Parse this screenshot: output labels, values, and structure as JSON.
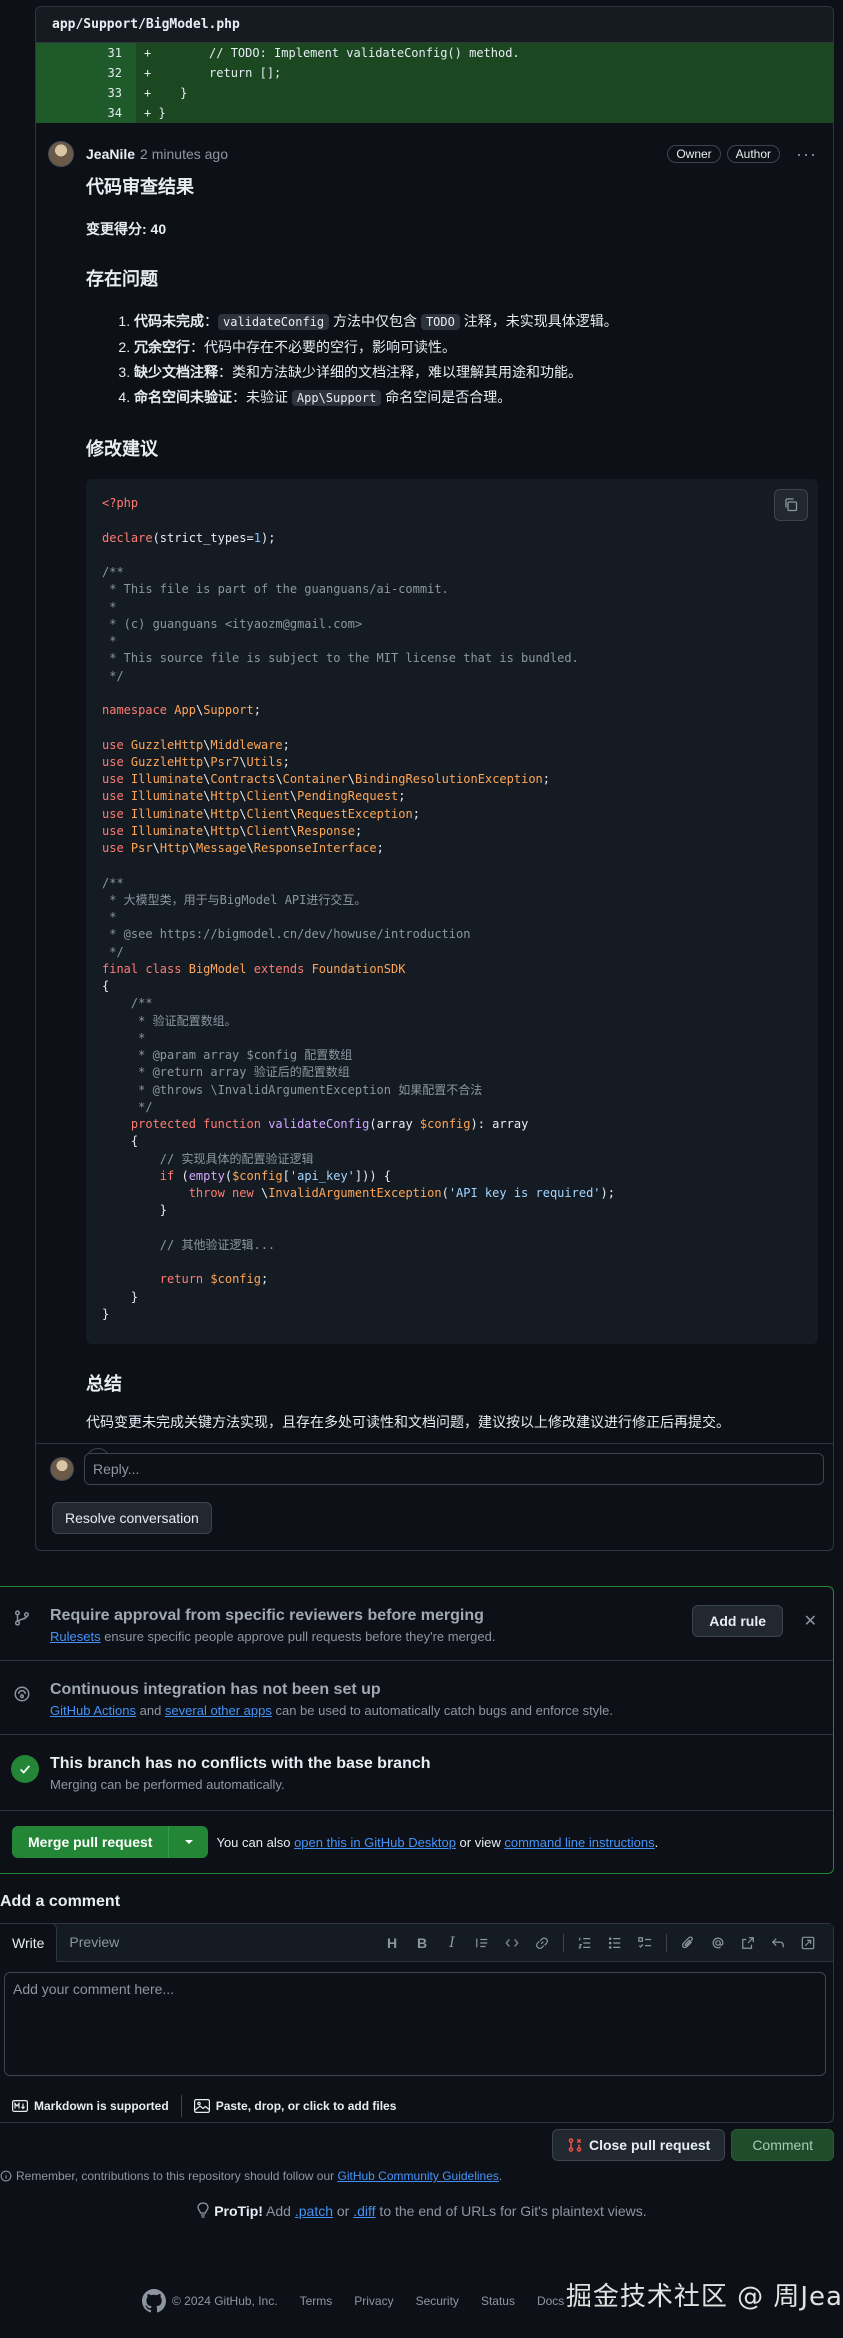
{
  "file": {
    "path": "app/Support/BigModel.php",
    "diff_lines": [
      {
        "num": "31",
        "code": "+        // TODO: Implement validateConfig() method."
      },
      {
        "num": "32",
        "code": "+        return [];"
      },
      {
        "num": "33",
        "code": "+    }"
      },
      {
        "num": "34",
        "code": "+ }"
      }
    ]
  },
  "comment": {
    "author": "JeaNile",
    "time": "2 minutes ago",
    "badges": [
      "Owner",
      "Author"
    ],
    "more": "···",
    "heading": "代码审查结果",
    "score_label": "变更得分: 40",
    "issues_heading": "存在问题",
    "issues": [
      {
        "title": "代码未完成",
        "pre": "：",
        "code1": "validateConfig",
        "mid": " 方法中仅包含 ",
        "code2": "TODO",
        "post": " 注释，未实现具体逻辑。"
      },
      {
        "title": "冗余空行",
        "pre": "：代码中存在不必要的空行，影响可读性。",
        "code1": "",
        "mid": "",
        "code2": "",
        "post": ""
      },
      {
        "title": "缺少文档注释",
        "pre": "：类和方法缺少详细的文档注释，难以理解其用途和功能。",
        "code1": "",
        "mid": "",
        "code2": "",
        "post": ""
      },
      {
        "title": "命名空间未验证",
        "pre": "：未验证 ",
        "code1": "App\\Support",
        "mid": " 命名空间是否合理。",
        "code2": "",
        "post": ""
      }
    ],
    "suggest_heading": "修改建议",
    "summary_heading": "总结",
    "summary_text": "代码变更未完成关键方法实现，且存在多处可读性和文档问题，建议按以上修改建议进行修正后再提交。"
  },
  "reply": {
    "placeholder": "Reply..."
  },
  "resolve_label": "Resolve conversation",
  "merge": {
    "approval_title": "Require approval from specific reviewers before merging",
    "approval_link": "Rulesets",
    "approval_text": " ensure specific people approve pull requests before they're merged.",
    "add_rule": "Add rule",
    "ci_title": "Continuous integration has not been set up",
    "ci_link1": "GitHub Actions",
    "ci_and": " and ",
    "ci_link2": "several other apps",
    "ci_text": " can be used to automatically catch bugs and enforce style.",
    "conflict_title": "This branch has no conflicts with the base branch",
    "conflict_text": "Merging can be performed automatically.",
    "merge_button": "Merge pull request",
    "also_text": "You can also ",
    "desktop_link": "open this in GitHub Desktop",
    "or_view": " or view ",
    "cli_link": "command line instructions",
    "period": "."
  },
  "add_comment": {
    "title": "Add a comment",
    "tab_write": "Write",
    "tab_preview": "Preview",
    "placeholder": "Add your comment here...",
    "markdown_note": "Markdown is supported",
    "files_note": "Paste, drop, or click to add files"
  },
  "actions": {
    "close_pr": "Close pull request",
    "comment": "Comment"
  },
  "guidelines": {
    "text": "Remember, contributions to this repository should follow our ",
    "link": "GitHub Community Guidelines",
    "end": "."
  },
  "protip": {
    "label": "ProTip!",
    "pre": " Add ",
    "patch": ".patch",
    "or": " or ",
    "diff": ".diff",
    "post": " to the end of URLs for Git's plaintext views."
  },
  "footer": {
    "copyright": "© 2024 GitHub, Inc.",
    "links": [
      "Terms",
      "Privacy",
      "Security",
      "Status",
      "Docs"
    ]
  },
  "watermark": "掘金技术社区 @ 周Jea"
}
